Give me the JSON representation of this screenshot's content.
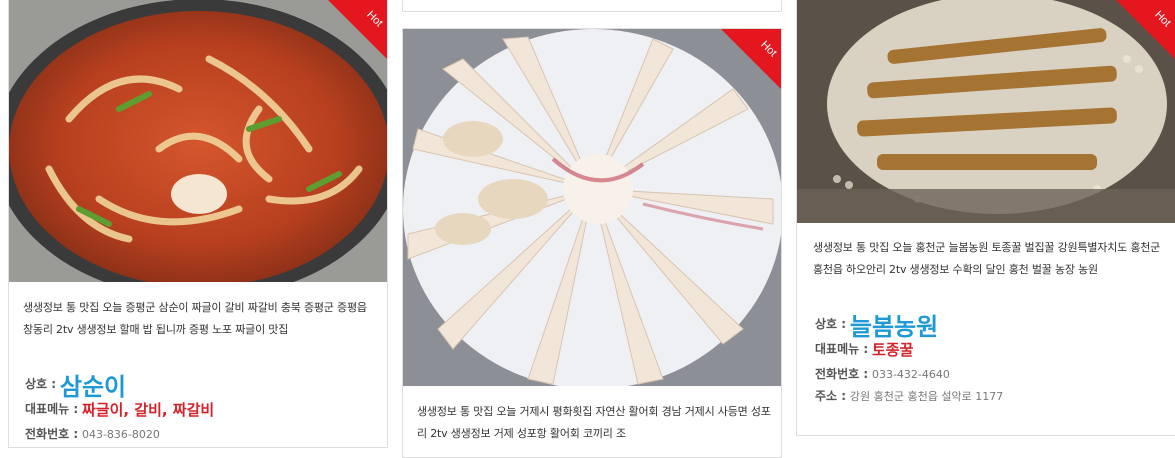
{
  "cards": [
    {
      "badge": "Hot",
      "description": "생생정보 통 맛집 오늘 증평군 삼순이 짜글이 갈비 짜갈비 충북 증평군 증평읍 창동리 2tv 생생정보 할매 밥 됩니까 증평 노포 짜글이 맛집",
      "name_label": "상호 :",
      "name": "삼순이",
      "menu_label": "대표메뉴 :",
      "menu": "짜글이, 갈비, 짜갈비",
      "phone_label": "전화번호 :",
      "phone": "043-836-8020"
    },
    {
      "badge": "Hot",
      "description": "생생정보 통 맛집 오늘 거제시 평화횟집 자연산 활어회 경남 거제시 사등면 성포리 2tv 생생정보 거제 성포항 활어회 코끼리 조"
    },
    {
      "badge": "Hot",
      "description": "생생정보 통 맛집 오늘 홍천군 늘봄농원 토종꿀 벌집꿀 강원특별자치도 홍천군 홍천읍 하오안리 2tv 생생정보 수확의 달인 홍천 벌꿀 농장 농원",
      "name_label": "상호 :",
      "name": "늘봄농원",
      "menu_label": "대표메뉴 :",
      "menu": "토종꿀",
      "phone_label": "전화번호 :",
      "phone": "033-432-4640",
      "address_label": "주소 :",
      "address": "강원 홍천군 홍천읍 설악로 1177"
    }
  ],
  "colors": {
    "hot_badge": "#e4171f",
    "name": "#1d9ad6",
    "menu": "#d4232b"
  }
}
